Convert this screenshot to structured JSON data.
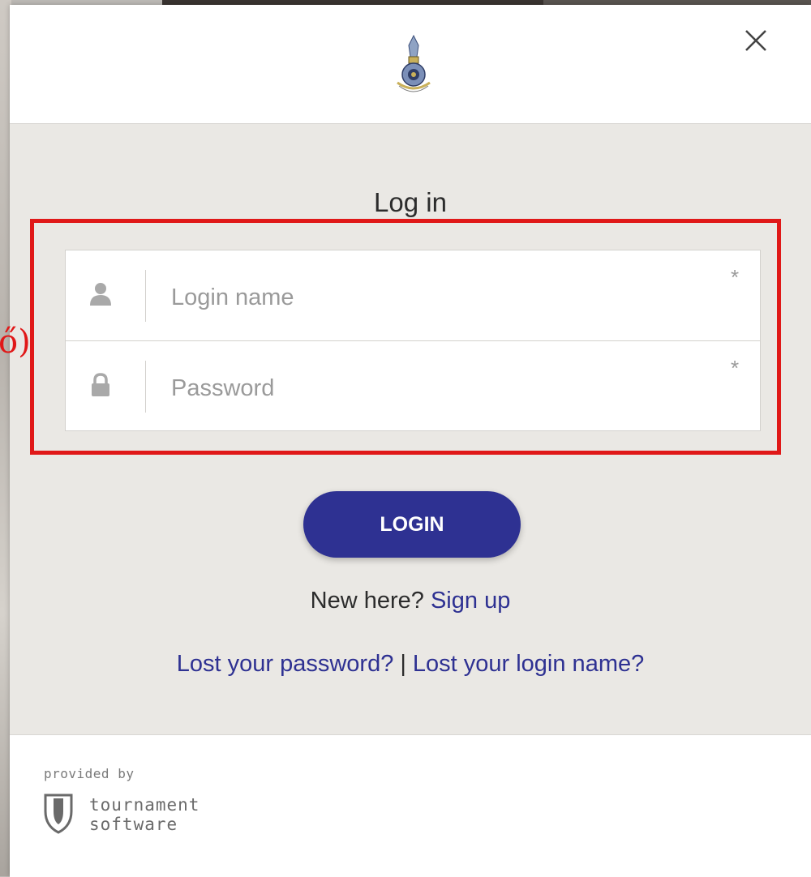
{
  "dialog": {
    "title": "Log in",
    "close_icon": "close-icon",
    "logo": "organization-emblem"
  },
  "form": {
    "login_name": {
      "placeholder": "Login name",
      "value": "",
      "required_mark": "*",
      "icon": "user-icon"
    },
    "password": {
      "placeholder": "Password",
      "value": "",
      "required_mark": "*",
      "icon": "lock-icon"
    },
    "highlight_color": "#e01818",
    "annotation_mark": "ő)"
  },
  "login_button": {
    "label": "LOGIN",
    "color": "#2e3192"
  },
  "signup": {
    "prompt": "New here?",
    "link": "Sign up"
  },
  "lost": {
    "password_link": "Lost your password?",
    "separator": "|",
    "login_name_link": "Lost your login name?"
  },
  "footer": {
    "provided_by": "provided by",
    "brand_line1": "tournament",
    "brand_line2": "software",
    "brand_icon": "tournament-software-shield-icon"
  },
  "colors": {
    "accent": "#2e3192",
    "body_bg": "#eae8e4",
    "highlight": "#e01818"
  }
}
